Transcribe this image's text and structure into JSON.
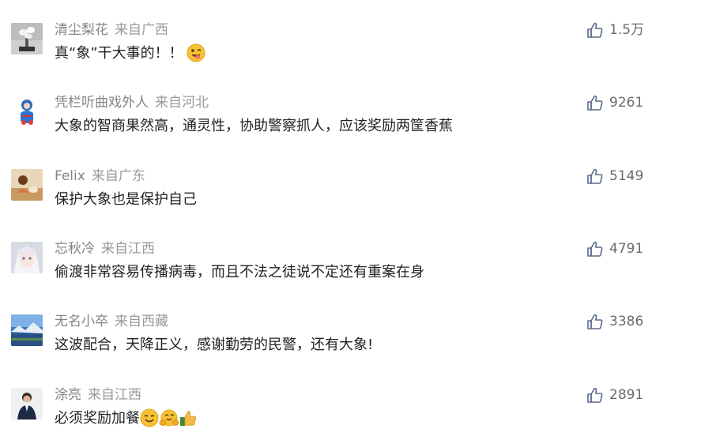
{
  "comments": [
    {
      "nickname": "清尘梨花",
      "location": "来自广西",
      "text": "真“象”干大事的！！",
      "emoji": "wink-tongue-emoji",
      "likes": "1.5万",
      "like_icon": "thumbs-up-icon"
    },
    {
      "nickname": "凭栏听曲戏外人",
      "location": "来自河北",
      "text": "大象的智商果然高，通灵性，协助警察抓人，应该奖励两筐香蕉",
      "likes": "9261",
      "like_icon": "thumbs-up-icon"
    },
    {
      "nickname": "Felix",
      "location": "来自广东",
      "text": "保护大象也是保护自己",
      "likes": "5149",
      "like_icon": "thumbs-up-icon"
    },
    {
      "nickname": "忘秋冷",
      "location": "来自江西",
      "text": "偷渡非常容易传播病毒，而且不法之徒说不定还有重案在身",
      "likes": "4791",
      "like_icon": "thumbs-up-icon"
    },
    {
      "nickname": "无名小卒",
      "location": "来自西藏",
      "text": "这波配合，天降正义，感谢勤劳的民警，还有大象!",
      "likes": "3386",
      "like_icon": "thumbs-up-icon"
    },
    {
      "nickname": "涂亮",
      "location": "来自江西",
      "text": "必须奖励加餐",
      "emojis": [
        "smile-emoji",
        "hug-emoji",
        "thumbs-up-emoji"
      ],
      "likes": "2891",
      "like_icon": "thumbs-up-icon"
    }
  ],
  "colors": {
    "nickname": "#858585",
    "location": "#9a9a9a",
    "text": "#222222",
    "like_icon": "#5b6b8c",
    "background": "#ffffff"
  }
}
